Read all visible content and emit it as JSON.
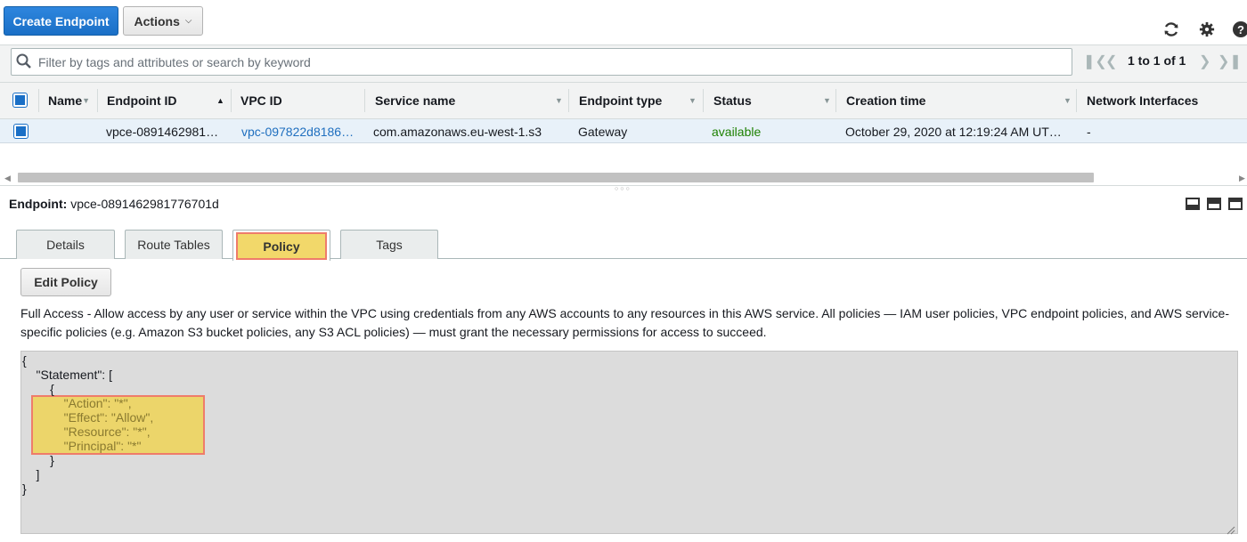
{
  "toolbar": {
    "create_label": "Create Endpoint",
    "actions_label": "Actions",
    "refresh_icon": "refresh-icon",
    "settings_icon": "gear-icon",
    "help_icon": "help-icon"
  },
  "filter": {
    "placeholder": "Filter by tags and attributes or search by keyword",
    "pagination": "1 to 1 of 1"
  },
  "table": {
    "columns": [
      "Name",
      "Endpoint ID",
      "VPC ID",
      "Service name",
      "Endpoint type",
      "Status",
      "Creation time",
      "Network Interfaces"
    ],
    "row": {
      "name": "",
      "endpoint_id": "vpce-0891462981…",
      "vpc_id": "vpc-097822d8186…",
      "service_name": "com.amazonaws.eu-west-1.s3",
      "endpoint_type": "Gateway",
      "status": "available",
      "creation_time": "October 29, 2020 at 12:19:24 AM UT…",
      "network_interfaces": "-"
    }
  },
  "detail": {
    "endpoint_label": "Endpoint:",
    "endpoint_value": "vpce-0891462981776701d",
    "tabs": [
      "Details",
      "Route Tables",
      "Policy",
      "Tags"
    ],
    "active_tab": "Policy",
    "edit_policy_label": "Edit Policy",
    "description": "Full Access - Allow access by any user or service within the VPC using credentials from any AWS accounts to any resources in this AWS service. All policies — IAM user policies, VPC endpoint policies, and AWS service-specific policies (e.g. Amazon S3 bucket policies, any S3 ACL policies) — must grant the necessary permissions for access to succeed.",
    "policy_lines": [
      "{",
      "    \"Statement\": [",
      "        {",
      "            \"Action\": \"*\",",
      "            \"Effect\": \"Allow\",",
      "            \"Resource\": \"*\",",
      "            \"Principal\": \"*\"",
      "        }",
      "    ]",
      "}"
    ]
  },
  "colors": {
    "primary": "#1a6fc6",
    "link": "#0073bb",
    "status_available": "#1d8102",
    "highlight": "#ecd56a",
    "highlight_border": "#ef7c6a"
  }
}
